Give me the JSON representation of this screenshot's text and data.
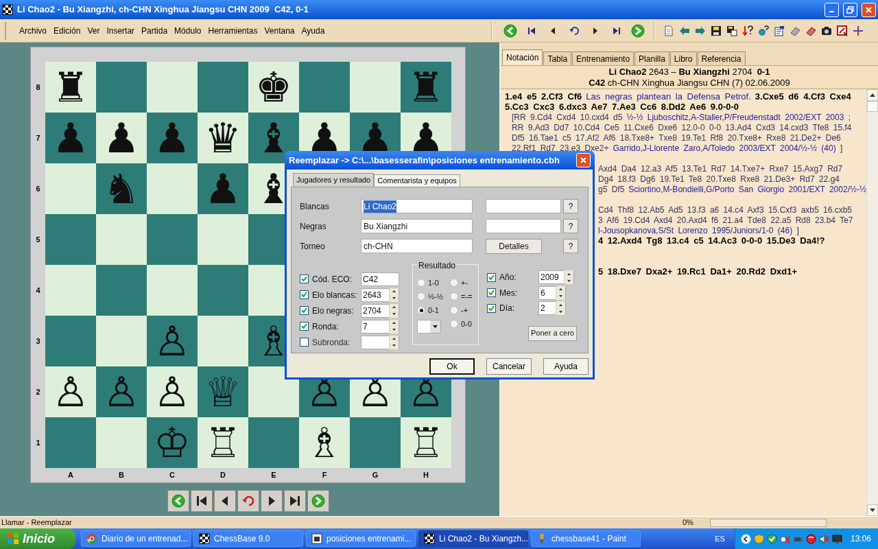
{
  "window": {
    "title": "Li Chao2 - Bu Xiangzhi, ch-CHN Xinghua Jiangsu CHN 2009  C42, 0-1"
  },
  "menu": [
    "Archivo",
    "Edición",
    "Ver",
    "Insertar",
    "Partida",
    "Módulo",
    "Herramientas",
    "Ventana",
    "Ayuda"
  ],
  "board": {
    "files": [
      "A",
      "B",
      "C",
      "D",
      "E",
      "F",
      "G",
      "H"
    ],
    "rows": [
      {
        "rank": "8",
        "cells": [
          {
            "piece": "♜"
          },
          {},
          {},
          {},
          {
            "piece": "♚"
          },
          {},
          {},
          {
            "piece": "♜"
          }
        ]
      },
      {
        "rank": "7",
        "cells": [
          {
            "piece": "♟"
          },
          {
            "piece": "♟"
          },
          {
            "piece": "♟"
          },
          {
            "piece": "♛"
          },
          {
            "piece": "♝"
          },
          {
            "piece": "♟"
          },
          {
            "piece": "♟"
          },
          {
            "piece": "♟"
          }
        ]
      },
      {
        "rank": "6",
        "cells": [
          {},
          {
            "piece": "♞"
          },
          {},
          {
            "piece": "♟"
          },
          {
            "piece": "♝"
          },
          {},
          {},
          {}
        ]
      },
      {
        "rank": "5",
        "cells": [
          {},
          {},
          {},
          {},
          {},
          {},
          {},
          {}
        ]
      },
      {
        "rank": "4",
        "cells": [
          {},
          {},
          {},
          {},
          {},
          {},
          {},
          {}
        ]
      },
      {
        "rank": "3",
        "cells": [
          {},
          {},
          {
            "piece": "♙"
          },
          {},
          {
            "piece": "♗"
          },
          {},
          {},
          {}
        ]
      },
      {
        "rank": "2",
        "cells": [
          {
            "piece": "♙"
          },
          {
            "piece": "♙"
          },
          {
            "piece": "♙"
          },
          {
            "piece": "♕"
          },
          {},
          {
            "piece": "♙"
          },
          {
            "piece": "♙"
          },
          {
            "piece": "♙"
          }
        ]
      },
      {
        "rank": "1",
        "cells": [
          {},
          {},
          {
            "piece": "♔"
          },
          {
            "piece": "♖"
          },
          {},
          {
            "piece": "♗"
          },
          {},
          {
            "piece": "♖"
          }
        ]
      }
    ]
  },
  "panel": {
    "tabs": [
      {
        "label": "Notación",
        "selected": true
      },
      {
        "label": "Tabla",
        "selected": false
      },
      {
        "label": "Entrenamiento",
        "selected": false
      },
      {
        "label": "Planilla",
        "selected": false
      },
      {
        "label": "Libro",
        "selected": false
      },
      {
        "label": "Referencia",
        "selected": false
      }
    ],
    "header": [
      "**Li Chao2** 2643 – **Bu Xiangzhi** 2704  **0-1**",
      "**C42** ch-CHN Xinghua Jiangsu CHN (7) 02.06.2009"
    ],
    "lines": [
      {
        "kind": "main",
        "clipped": false,
        "segments": [
          {
            "kind": "move",
            "text": "1.e4 e5 2.Cf3 Cf6"
          },
          {
            "kind": "comment",
            "text": "Las negras plantean la Defensa Petrof."
          },
          {
            "kind": "move",
            "text": "3.Cxe5 d6 4.Cf3 Cxe4"
          }
        ]
      },
      {
        "kind": "main",
        "clipped": false,
        "segments": [
          {
            "kind": "move",
            "text": "5.Cc3 Cxc3 6.dxc3 Ae7 7.Ae3 Cc6 8.Dd2 Ae6 9.0-0-0"
          }
        ]
      },
      {
        "kind": "variation",
        "clipped": false,
        "segments": [
          {
            "kind": "move",
            "text": "[RR 9.Cd4 Cxd4 10.cxd4 d5"
          },
          {
            "kind": "comment",
            "text": "½-½ Ljuboschitz,A-Staller,P/Freudenstadt 2002/EXT 2003 ;"
          }
        ]
      },
      {
        "kind": "variation",
        "clipped": false,
        "segments": [
          {
            "kind": "move",
            "text": "RR 9.Ad3 Dd7 10.Cd4 Ce5 11.Cxe6 Dxe6 12.0-0 0-0 13.Ad4 Cxd3 14.cxd3 Tfe8 15.f4"
          }
        ]
      },
      {
        "kind": "variation",
        "clipped": false,
        "segments": [
          {
            "kind": "move",
            "text": "Df5 16.Tae1 c5 17.Af2 Af6 18.Txe8+ Txe8 19.Te1 Rf8 20.Txe8+ Rxe8 21.De2+ De6"
          }
        ]
      },
      {
        "kind": "variation",
        "clipped": false,
        "segments": [
          {
            "kind": "move",
            "text": "22.Rf1 Rd7 23.e3 Dxe2+"
          },
          {
            "kind": "comment",
            "text": "Garrido,J-Llorente Zaro,A/Toledo 2003/EXT 2004/½-½ (40) ]"
          }
        ]
      },
      {
        "kind": "gap"
      },
      {
        "kind": "variation",
        "clipped": true,
        "segments": [
          {
            "kind": "move",
            "text": "Axd4 Da4 12.a3 Af5 13.Te1 Rd7 14.Txe7+ Rxe7 15.Axg7 Rd7"
          }
        ]
      },
      {
        "kind": "variation",
        "clipped": true,
        "segments": [
          {
            "kind": "move",
            "text": "Dg4 18.f3 Dg6 19.Te1 Te8 20.Txe8 Rxe8 21.De3+ Rd7 22.g4"
          }
        ]
      },
      {
        "kind": "variation",
        "clipped": true,
        "segments": [
          {
            "kind": "move",
            "text": "g5 Df5"
          },
          {
            "kind": "comment",
            "text": "Sciortino,M-Bondielli,G/Porto San Giorgio 2001/EXT 2002/½-½"
          }
        ]
      },
      {
        "kind": "gap"
      },
      {
        "kind": "variation",
        "clipped": true,
        "segments": [
          {
            "kind": "move",
            "text": "Cd4 Thf8 12.Ab5 Ad5 13.f3 a6 14.c4 Axf3 15.Cxf3 axb5 16.cxb5"
          }
        ]
      },
      {
        "kind": "variation",
        "clipped": true,
        "segments": [
          {
            "kind": "move",
            "text": "3 Af6 19.Cd4 Axd4 20.Axd4 f6 21.a4 Tde8 22.a5 Rd8 23.b4 Te7"
          }
        ]
      },
      {
        "kind": "variation",
        "clipped": true,
        "segments": [
          {
            "kind": "comment",
            "text": "l-Jousopkanova,S/St Lorenzo 1995/Juniors/1-0 (46) ]"
          }
        ]
      },
      {
        "kind": "main",
        "clipped": true,
        "segments": [
          {
            "kind": "move",
            "text": "4 12.Axd4 Tg8 13.c4 c5 14.Ac3 0-0-0 15.De3 Da4!?"
          }
        ]
      },
      {
        "kind": "gap"
      },
      {
        "kind": "gap"
      },
      {
        "kind": "main",
        "clipped": true,
        "segments": [
          {
            "kind": "move",
            "text": "5 18.Dxe7 Dxa2+ 19.Rc1 Da1+ 20.Rd2 Dxd1+"
          }
        ]
      }
    ]
  },
  "dialog": {
    "title": "Reemplazar -> C:\\...\\basesserafin\\posiciones entrenamiento.cbh",
    "tabs": [
      {
        "label": "Jugadores y resultado",
        "selected": true
      },
      {
        "label": "Comentarista y equipos",
        "selected": false
      }
    ],
    "players": [
      {
        "label": "Blancas",
        "value": "Li Chao2",
        "selected": true,
        "kind": "player"
      },
      {
        "label": "Negras",
        "value": "Bu Xiangzhi",
        "selected": false,
        "kind": "player"
      },
      {
        "label": "Torneo",
        "value": "ch-CHN",
        "selected": false,
        "kind": "tournament",
        "button": "Detalles"
      }
    ],
    "help_buttons": [
      "?",
      "?",
      "?"
    ],
    "checks": [
      {
        "label": "Cód. ECO:",
        "checked": true,
        "value": "C42",
        "kind": "text"
      },
      {
        "label": "Elo blancas:",
        "checked": true,
        "value": "2643",
        "kind": "spin"
      },
      {
        "label": "Elo negras:",
        "checked": true,
        "value": "2704",
        "kind": "spin"
      },
      {
        "label": "Ronda:",
        "checked": true,
        "value": "7",
        "kind": "spin"
      },
      {
        "label": "Subronda:",
        "checked": false,
        "kind": "spin"
      }
    ],
    "result": {
      "label": "Resultado",
      "options": [
        {
          "label": "1-0",
          "selected": false
        },
        {
          "label": "½-½",
          "selected": false
        },
        {
          "label": "0-1",
          "selected": true
        },
        {
          "label": "+-",
          "selected": false
        },
        {
          "label": "=-=",
          "selected": false
        },
        {
          "label": "-+",
          "selected": false
        },
        {
          "label": "0-0",
          "selected": false
        }
      ]
    },
    "date": [
      {
        "label": "Año:",
        "checked": true,
        "value": "2009"
      },
      {
        "label": "Mes:",
        "checked": true,
        "value": "6"
      },
      {
        "label": "Día:",
        "checked": true,
        "value": "2"
      }
    ],
    "reset_button": "Poner a cero",
    "buttons": [
      {
        "label": "Ok",
        "selected": true
      },
      {
        "label": "Cancelar",
        "selected": false
      },
      {
        "label": "Ayuda",
        "selected": false
      }
    ]
  },
  "status_bar": {
    "text": "Llamar - Reemplazar",
    "percent": "0%",
    "level": 0
  },
  "taskbar": {
    "start": "Inicio",
    "tasks": [
      {
        "label": "Diario de un entrenad...",
        "kind": "browser",
        "selected": false
      },
      {
        "label": "ChessBase 9.0",
        "kind": "chess",
        "selected": false
      },
      {
        "label": "posiciones entrenami...",
        "kind": "window",
        "selected": false
      },
      {
        "label": "Li Chao2 - Bu Xiangzh...",
        "kind": "board",
        "selected": true
      },
      {
        "label": "chessbase41 - Paint",
        "kind": "paint",
        "selected": false
      }
    ],
    "language": "ES",
    "clock": "13:06"
  }
}
